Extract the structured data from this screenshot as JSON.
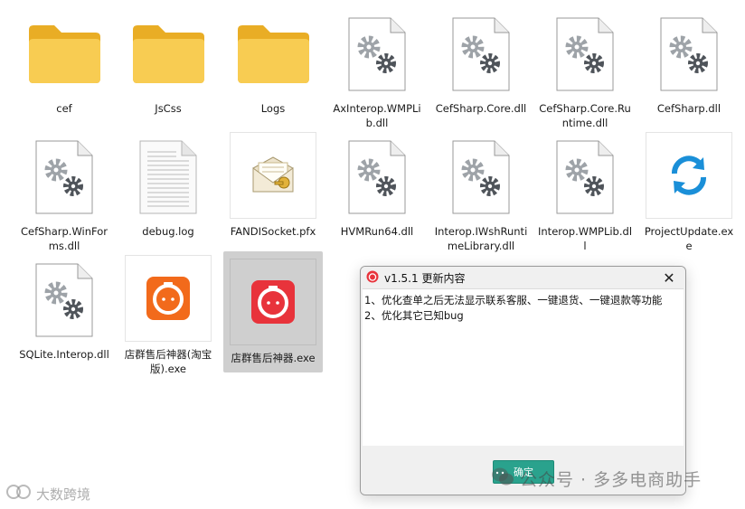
{
  "files": [
    {
      "name": "cef",
      "type": "folder"
    },
    {
      "name": "JsCss",
      "type": "folder"
    },
    {
      "name": "Logs",
      "type": "folder"
    },
    {
      "name": "AxInterop.WMPLib.dll",
      "type": "dll"
    },
    {
      "name": "CefSharp.Core.dll",
      "type": "dll"
    },
    {
      "name": "CefSharp.Core.Runtime.dll",
      "type": "dll"
    },
    {
      "name": "CefSharp.dll",
      "type": "dll"
    },
    {
      "name": "CefSharp.WinForms.dll",
      "type": "dll"
    },
    {
      "name": "debug.log",
      "type": "text"
    },
    {
      "name": "FANDISocket.pfx",
      "type": "certificate"
    },
    {
      "name": "HVMRun64.dll",
      "type": "dll"
    },
    {
      "name": "Interop.IWshRuntimeLibrary.dll",
      "type": "dll"
    },
    {
      "name": "Interop.WMPLib.dll",
      "type": "dll"
    },
    {
      "name": "ProjectUpdate.exe",
      "type": "update-exe"
    },
    {
      "name": "SQLite.Interop.dll",
      "type": "dll"
    },
    {
      "name": "店群售后神器(淘宝版).exe",
      "type": "app-orange"
    },
    {
      "name": "店群售后神器.exe",
      "type": "app-red"
    }
  ],
  "dialog": {
    "title": "v1.5.1 更新内容",
    "lines": [
      "1、优化查单之后无法显示联系客服、一键退货、一键退款等功能",
      "2、优化其它已知bug"
    ],
    "ok_label": "确定",
    "close_glyph": "✕"
  },
  "watermarks": {
    "right": "公众号 · 多多电商助手",
    "left": "大数跨境"
  },
  "colors": {
    "folder": "#f6c443",
    "dll_gear": "#5a5f66",
    "ok_button": "#2aa28d",
    "app_orange": "#f26a1b",
    "app_red": "#e8333b",
    "update_blue": "#1a8fd8",
    "selected_bg": "#cfcfcf"
  }
}
